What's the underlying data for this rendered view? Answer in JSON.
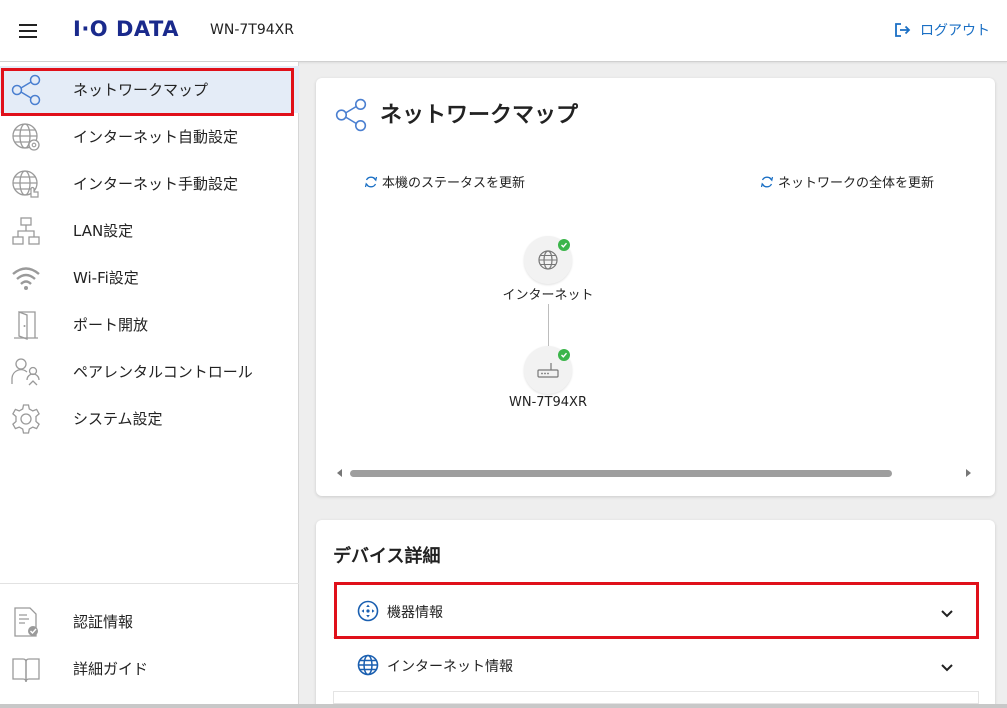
{
  "header": {
    "brand": "I·O DATA",
    "model": "WN-7T94XR",
    "logout_label": "ログアウト",
    "accent": "#1a6fc4",
    "brand_color": "#1a2a8c"
  },
  "sidebar": {
    "items": [
      {
        "label": "ネットワークマップ",
        "icon": "share-nodes-icon",
        "active": true
      },
      {
        "label": "インターネット自動設定",
        "icon": "globe-gear-icon"
      },
      {
        "label": "インターネット手動設定",
        "icon": "globe-hand-icon"
      },
      {
        "label": "LAN設定",
        "icon": "lan-tree-icon"
      },
      {
        "label": "Wi-Fi設定",
        "icon": "wifi-icon"
      },
      {
        "label": "ポート開放",
        "icon": "door-open-icon"
      },
      {
        "label": "ペアレンタルコントロール",
        "icon": "parent-child-icon"
      },
      {
        "label": "システム設定",
        "icon": "gear-icon"
      }
    ],
    "bottom_items": [
      {
        "label": "認証情報",
        "icon": "certificate-icon"
      },
      {
        "label": "詳細ガイド",
        "icon": "book-icon"
      }
    ]
  },
  "network_map": {
    "title": "ネットワークマップ",
    "refresh_device": "本機のステータスを更新",
    "refresh_network": "ネットワークの全体を更新",
    "nodes": [
      {
        "label": "インターネット",
        "icon": "globe-icon",
        "status": "ok"
      },
      {
        "label": "WN-7T94XR",
        "icon": "router-icon",
        "status": "ok"
      }
    ]
  },
  "device_details": {
    "title": "デバイス詳細",
    "items": [
      {
        "label": "機器情報",
        "icon": "device-info-icon",
        "highlighted": true
      },
      {
        "label": "インターネット情報",
        "icon": "globe-icon"
      }
    ]
  },
  "colors": {
    "highlight": "#e0101a",
    "active_bg": "#e4ecf7",
    "status_ok": "#3bb54a"
  }
}
